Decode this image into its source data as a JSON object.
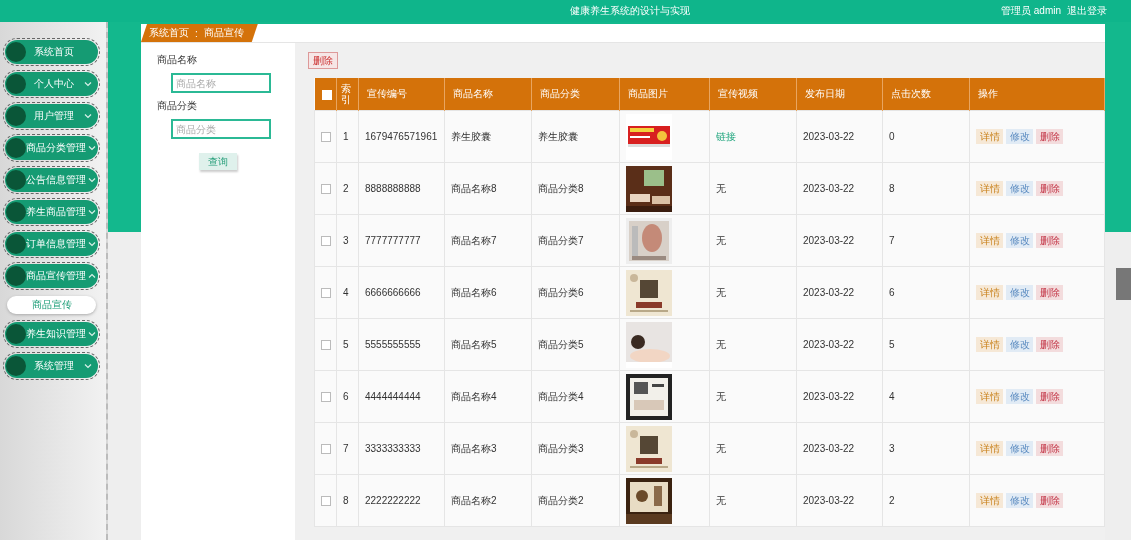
{
  "header": {
    "title": "健康养生系统的设计与实现",
    "user": "管理员 admin",
    "logout": "退出登录"
  },
  "sidebar": {
    "items": [
      {
        "label": "系统首页",
        "kind": "link"
      },
      {
        "label": "个人中心",
        "kind": "menu",
        "expanded": false
      },
      {
        "label": "用户管理",
        "kind": "menu",
        "expanded": false
      },
      {
        "label": "商品分类管理",
        "kind": "menu",
        "expanded": false
      },
      {
        "label": "公告信息管理",
        "kind": "menu",
        "expanded": false
      },
      {
        "label": "养生商品管理",
        "kind": "menu",
        "expanded": false
      },
      {
        "label": "订单信息管理",
        "kind": "menu",
        "expanded": false
      },
      {
        "label": "商品宣传管理",
        "kind": "menu",
        "expanded": true,
        "children": [
          {
            "label": "商品宣传"
          }
        ]
      },
      {
        "label": "养生知识管理",
        "kind": "menu",
        "expanded": false
      },
      {
        "label": "系统管理",
        "kind": "menu",
        "expanded": false
      }
    ]
  },
  "breadcrumb": {
    "items": [
      "系统首页",
      "商品宣传"
    ],
    "separator": ":"
  },
  "search": {
    "fields": [
      {
        "label": "商品名称",
        "placeholder": "商品名称"
      },
      {
        "label": "商品分类",
        "placeholder": "商品分类"
      }
    ],
    "button": "查询"
  },
  "toolbar": {
    "delete_button": "删除"
  },
  "table": {
    "all_checked": false,
    "columns": [
      "索引",
      "宣传编号",
      "商品名称",
      "商品分类",
      "商品图片",
      "宣传视频",
      "发布日期",
      "点击次数",
      "操作"
    ],
    "rows": [
      {
        "checked": false,
        "index": "1",
        "code": "1679476571961",
        "name": "养生胶囊",
        "category": "养生胶囊",
        "video": {
          "text": "链接",
          "kind": "link"
        },
        "date": "2023-03-22",
        "clicks": "0",
        "actions": [
          "详情",
          "修改",
          "删除"
        ]
      },
      {
        "checked": false,
        "index": "2",
        "code": "8888888888",
        "name": "商品名称8",
        "category": "商品分类8",
        "video": {
          "text": "无",
          "kind": "none"
        },
        "date": "2023-03-22",
        "clicks": "8",
        "actions": [
          "详情",
          "修改",
          "删除"
        ]
      },
      {
        "checked": false,
        "index": "3",
        "code": "7777777777",
        "name": "商品名称7",
        "category": "商品分类7",
        "video": {
          "text": "无",
          "kind": "none"
        },
        "date": "2023-03-22",
        "clicks": "7",
        "actions": [
          "详情",
          "修改",
          "删除"
        ]
      },
      {
        "checked": false,
        "index": "4",
        "code": "6666666666",
        "name": "商品名称6",
        "category": "商品分类6",
        "video": {
          "text": "无",
          "kind": "none"
        },
        "date": "2023-03-22",
        "clicks": "6",
        "actions": [
          "详情",
          "修改",
          "删除"
        ]
      },
      {
        "checked": false,
        "index": "5",
        "code": "5555555555",
        "name": "商品名称5",
        "category": "商品分类5",
        "video": {
          "text": "无",
          "kind": "none"
        },
        "date": "2023-03-22",
        "clicks": "5",
        "actions": [
          "详情",
          "修改",
          "删除"
        ]
      },
      {
        "checked": false,
        "index": "6",
        "code": "4444444444",
        "name": "商品名称4",
        "category": "商品分类4",
        "video": {
          "text": "无",
          "kind": "none"
        },
        "date": "2023-03-22",
        "clicks": "4",
        "actions": [
          "详情",
          "修改",
          "删除"
        ]
      },
      {
        "checked": false,
        "index": "7",
        "code": "3333333333",
        "name": "商品名称3",
        "category": "商品分类3",
        "video": {
          "text": "无",
          "kind": "none"
        },
        "date": "2023-03-22",
        "clicks": "3",
        "actions": [
          "详情",
          "修改",
          "删除"
        ]
      },
      {
        "checked": false,
        "index": "8",
        "code": "2222222222",
        "name": "商品名称2",
        "category": "商品分类2",
        "video": {
          "text": "无",
          "kind": "none"
        },
        "date": "2023-03-22",
        "clicks": "2",
        "actions": [
          "详情",
          "修改",
          "删除"
        ]
      }
    ]
  }
}
